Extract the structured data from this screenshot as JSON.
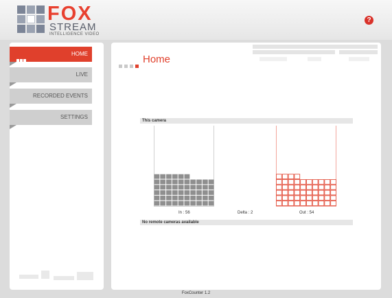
{
  "header": {
    "brand_fox": "FOX",
    "brand_stream": "STREAM",
    "brand_tagline": "INTELLIGENCE VIDEO",
    "help_icon": "?"
  },
  "sidebar": {
    "items": [
      {
        "label": "HOME",
        "active": true
      },
      {
        "label": "LIVE",
        "active": false
      },
      {
        "label": "RECORDED EVENTS",
        "active": false
      },
      {
        "label": "SETTINGS",
        "active": false
      }
    ]
  },
  "main": {
    "title": "Home",
    "this_camera_label": "This camera",
    "in_label": "In : 56",
    "delta_label": "Delta : 2",
    "out_label": "Out : 54",
    "in_count": 56,
    "out_count": 54,
    "remote_label": "No remote cameras available"
  },
  "footer": {
    "version": "FoxCounter 1.2"
  },
  "colors": {
    "accent": "#e0402c",
    "in_cell": "#8f8f8f",
    "out_cell": "#e0402c",
    "frame_in": "#d0d0d0",
    "frame_out": "#f2a59b"
  }
}
